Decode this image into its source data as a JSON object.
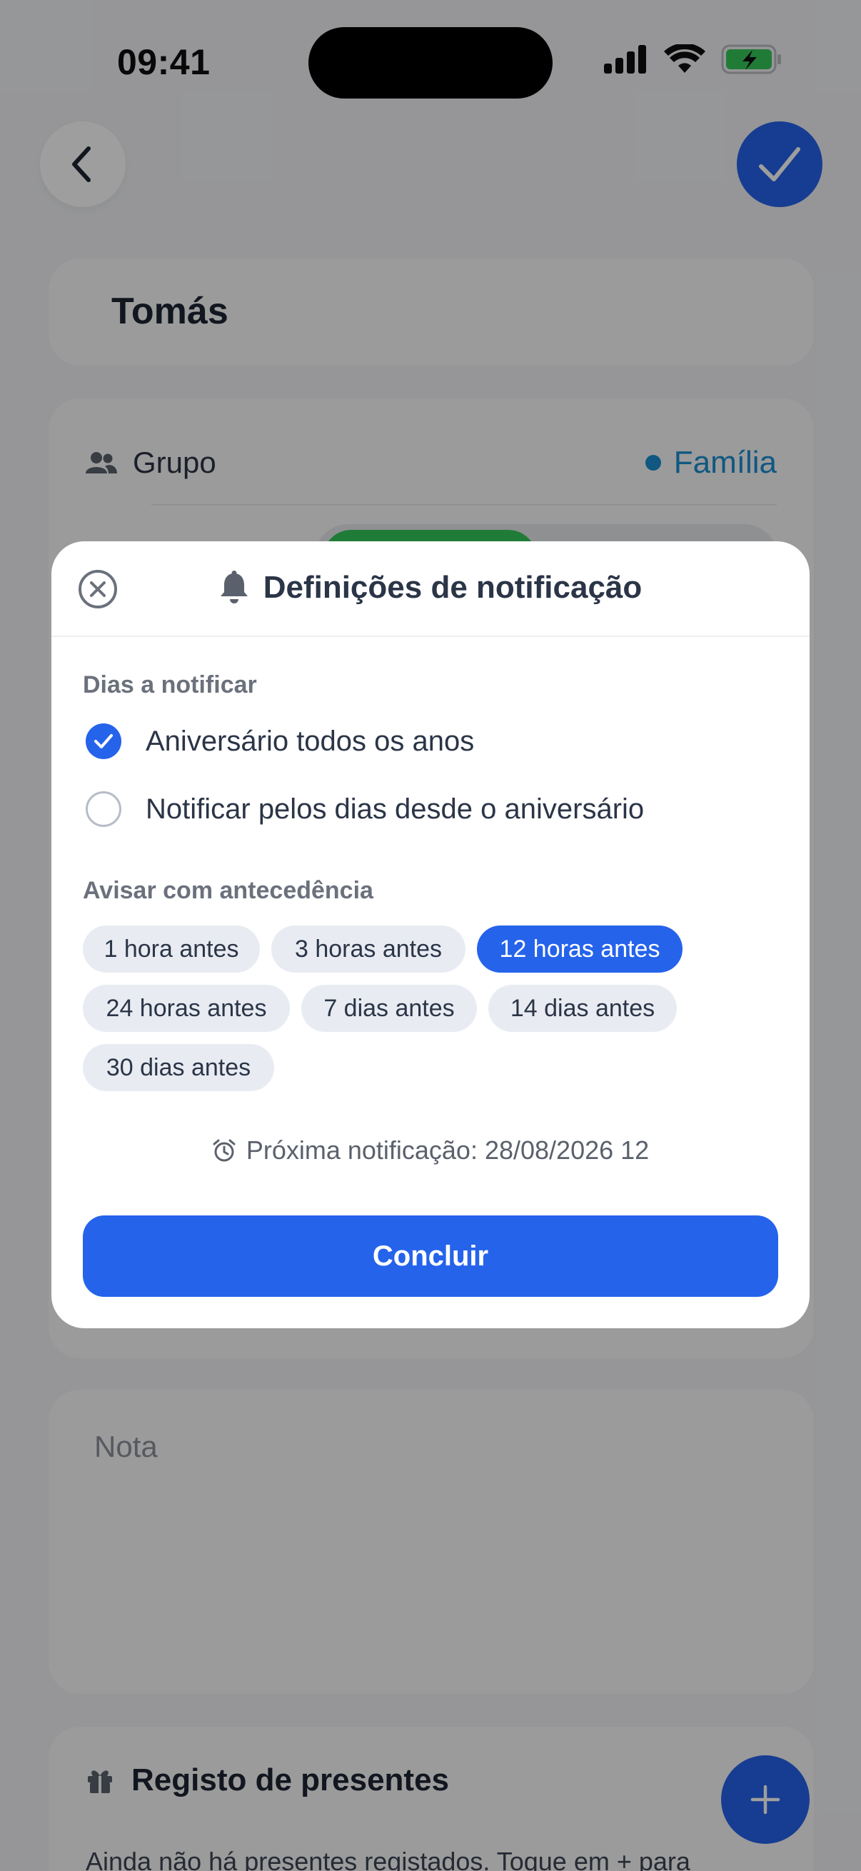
{
  "status_bar": {
    "time": "09:41"
  },
  "form": {
    "name": "Tomás",
    "group_label": "Grupo",
    "group_value": "Família",
    "group_color": "#1a8fd1",
    "note_placeholder": "Nota"
  },
  "gifts": {
    "title": "Registo de presentes",
    "empty_text": "Ainda não há presentes registados. Toque em + para"
  },
  "modal": {
    "title": "Definições de notificação",
    "days_section_label": "Dias a notificar",
    "options": [
      {
        "label": "Aniversário todos os anos",
        "checked": true
      },
      {
        "label": "Notificar pelos dias desde o aniversário",
        "checked": false
      }
    ],
    "advance_section_label": "Avisar com antecedência",
    "chips": [
      {
        "label": "1 hora antes",
        "active": false
      },
      {
        "label": "3 horas antes",
        "active": false
      },
      {
        "label": "12 horas antes",
        "active": true
      },
      {
        "label": "24 horas antes",
        "active": false
      },
      {
        "label": "7 dias antes",
        "active": false
      },
      {
        "label": "14 dias antes",
        "active": false
      },
      {
        "label": "30 dias antes",
        "active": false
      }
    ],
    "next_notification": "Próxima notificação: 28/08/2026 12",
    "done_label": "Concluir"
  },
  "colors": {
    "accent": "#2563eb",
    "toggle_on": "#34c759"
  },
  "icons": {
    "back": "chevron-left-icon",
    "confirm": "checkmark-icon",
    "group": "people-icon",
    "close": "close-circle-icon",
    "bell": "bell-icon",
    "alarm": "alarm-clock-icon",
    "gift": "gift-icon",
    "add": "plus-icon"
  }
}
